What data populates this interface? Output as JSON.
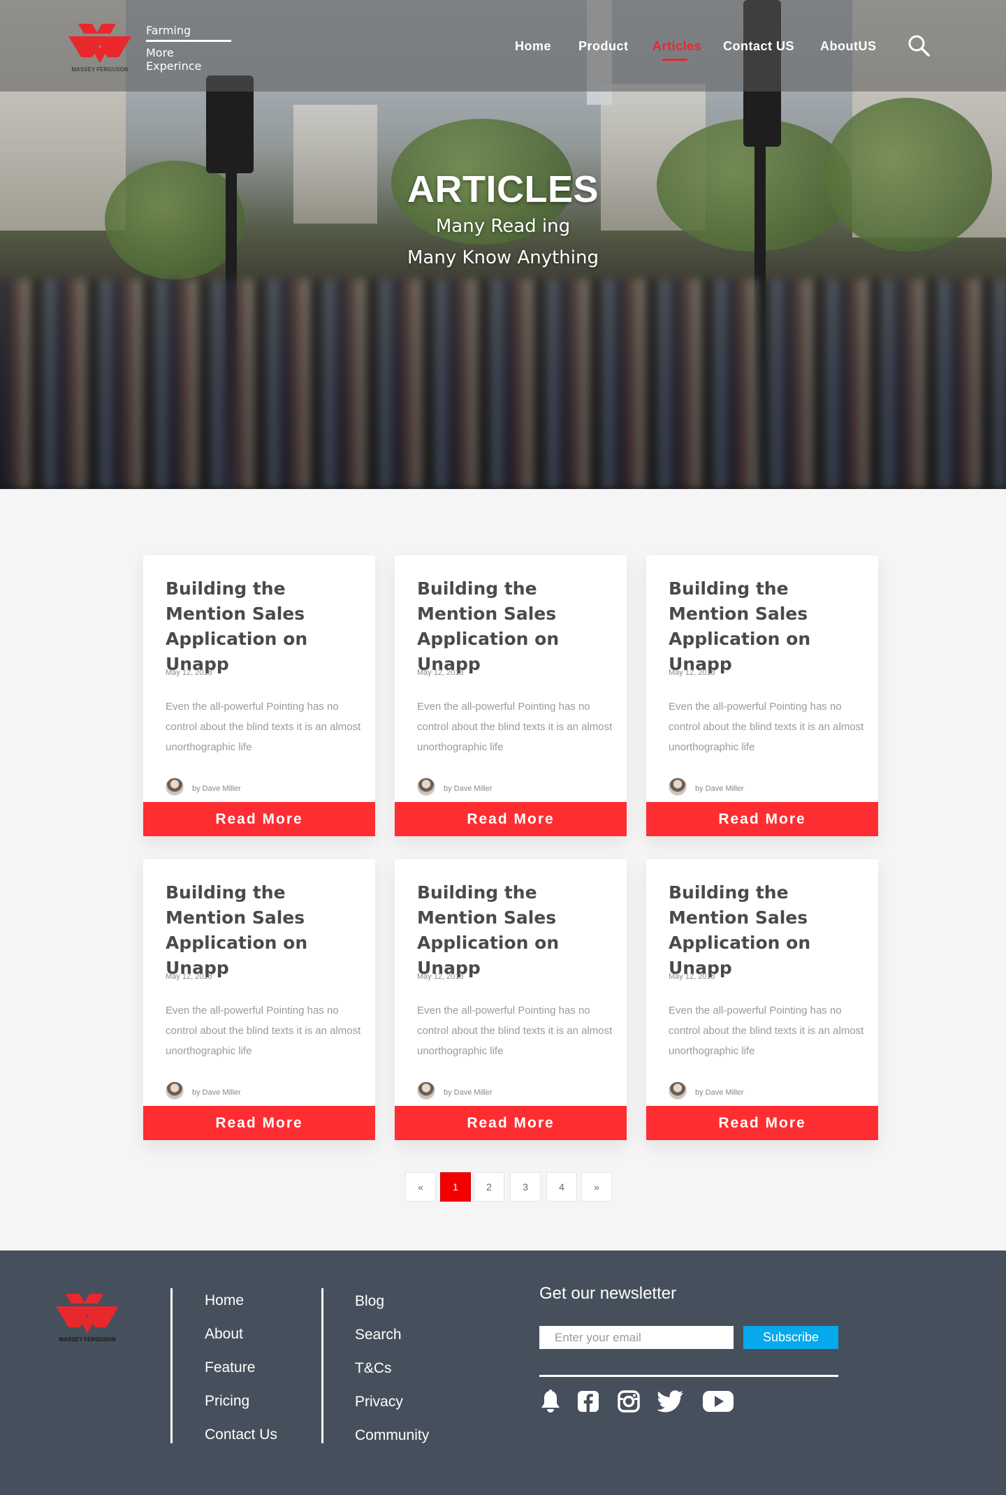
{
  "brand": {
    "logo_text": "MASSEY FERGUSON",
    "tagline_line1": "Farming",
    "tagline_line2": "More Experince"
  },
  "nav": {
    "items": [
      "Home",
      "Product",
      "Articles",
      "Contact US",
      "AboutUS"
    ],
    "active": "Articles"
  },
  "hero": {
    "title": "ARTICLES",
    "subtitle_line1": "Many Read ing",
    "subtitle_line2": "Many Know Anything"
  },
  "articles": [
    {
      "title": "Building the Mention Sales Application on Unapp",
      "date": "May 12, 2018",
      "excerpt": "Even the all-powerful Pointing has no control about the blind texts it is an almost unorthographic life",
      "author": "by Dave Miller",
      "cta": "Read More"
    },
    {
      "title": "Building the Mention Sales Application on Unapp",
      "date": "May 12, 2018",
      "excerpt": "Even the all-powerful Pointing has no control about the blind texts it is an almost unorthographic life",
      "author": "by Dave Miller",
      "cta": "Read More"
    },
    {
      "title": "Building the Mention Sales Application on Unapp",
      "date": "May 12, 2018",
      "excerpt": "Even the all-powerful Pointing has no control about the blind texts it is an almost unorthographic life",
      "author": "by Dave Miller",
      "cta": "Read More"
    },
    {
      "title": "Building the Mention Sales Application on Unapp",
      "date": "May 12, 2018",
      "excerpt": "Even the all-powerful Pointing has no control about the blind texts it is an almost unorthographic life",
      "author": "by Dave Miller",
      "cta": "Read More"
    },
    {
      "title": "Building the Mention Sales Application on Unapp",
      "date": "May 12, 2018",
      "excerpt": "Even the all-powerful Pointing has no control about the blind texts it is an almost unorthographic life",
      "author": "by Dave Miller",
      "cta": "Read More"
    },
    {
      "title": "Building the Mention Sales Application on Unapp",
      "date": "May 12, 2018",
      "excerpt": "Even the all-powerful Pointing has no control about the blind texts it is an almost unorthographic life",
      "author": "by Dave Miller",
      "cta": "Read More"
    }
  ],
  "pagination": {
    "prev": "«",
    "pages": [
      "1",
      "2",
      "3",
      "4"
    ],
    "next": "»",
    "current": "1"
  },
  "footer": {
    "col1": [
      "Home",
      "About",
      "Feature",
      "Pricing",
      "Contact Us"
    ],
    "col2": [
      "Blog",
      "Search",
      "T&Cs",
      "Privacy",
      "Community"
    ],
    "newsletter_title": "Get our newsletter",
    "email_placeholder": "Enter your email",
    "subscribe_label": "Subscribe",
    "social": [
      "bell-icon",
      "facebook-icon",
      "instagram-icon",
      "twitter-icon",
      "youtube-icon"
    ]
  },
  "colors": {
    "accent": "#fd2d31",
    "active_nav": "#e8282c",
    "footer_bg": "#46505c",
    "subscribe": "#06a9eb",
    "page_active": "#f40000"
  }
}
